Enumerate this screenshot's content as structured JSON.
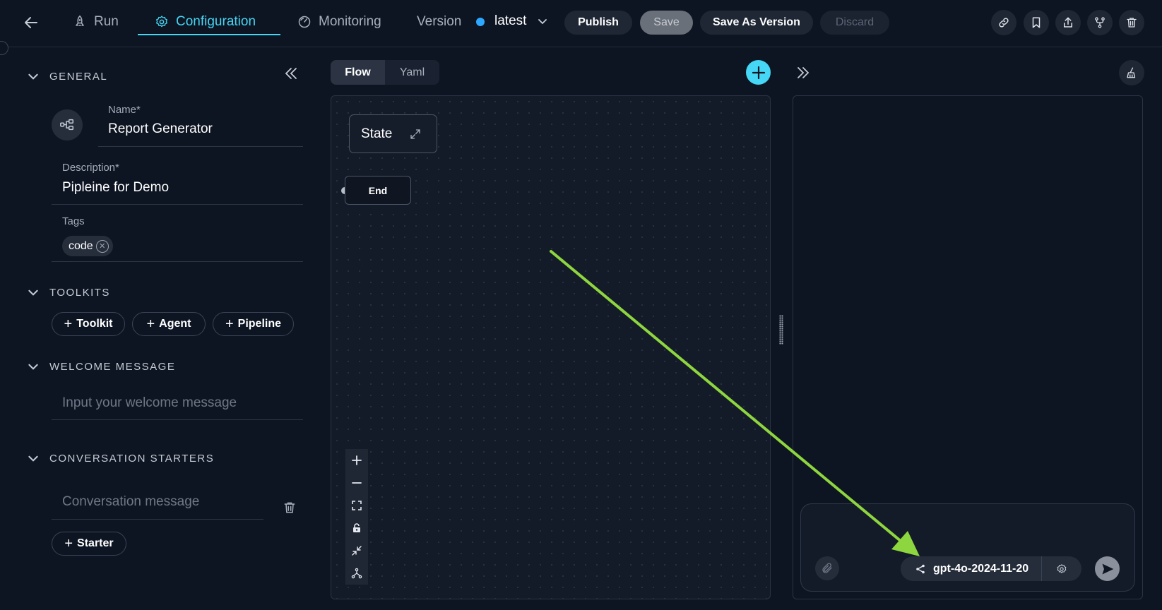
{
  "topbar": {
    "tabs": [
      {
        "label": "Run",
        "icon": "rocket-icon"
      },
      {
        "label": "Configuration",
        "icon": "gear-icon"
      },
      {
        "label": "Monitoring",
        "icon": "gauge-icon"
      }
    ],
    "version_label": "Version",
    "version_value": "latest",
    "buttons": {
      "publish": "Publish",
      "save": "Save",
      "save_as_version": "Save As Version",
      "discard": "Discard"
    },
    "action_icons": [
      "link-icon",
      "bookmark-icon",
      "share-icon",
      "fork-icon",
      "trash-icon"
    ],
    "accent_color": "#45d7f5"
  },
  "left": {
    "general": {
      "heading": "GENERAL",
      "name_label": "Name*",
      "name_value": "Report Generator",
      "description_label": "Description*",
      "description_value": "Pipleine for Demo",
      "tags_label": "Tags",
      "tags": [
        "code"
      ]
    },
    "toolkits": {
      "heading": "TOOLKITS",
      "buttons": [
        "Toolkit",
        "Agent",
        "Pipeline"
      ]
    },
    "welcome": {
      "heading": "WELCOME MESSAGE",
      "placeholder": "Input your welcome message"
    },
    "starters": {
      "heading": "CONVERSATION STARTERS",
      "placeholder": "Conversation message",
      "add_label": "Starter"
    }
  },
  "canvas": {
    "view_tabs": [
      "Flow",
      "Yaml"
    ],
    "active_view": "Flow",
    "nodes": {
      "state": "State",
      "end": "End"
    },
    "controls": [
      "zoom-in-icon",
      "zoom-out-icon",
      "fit-view-icon",
      "lock-icon",
      "collapse-icon",
      "layout-icon"
    ]
  },
  "chat": {
    "model": "gpt-4o-2024-11-20",
    "arrow_color": "#8ed63f"
  }
}
